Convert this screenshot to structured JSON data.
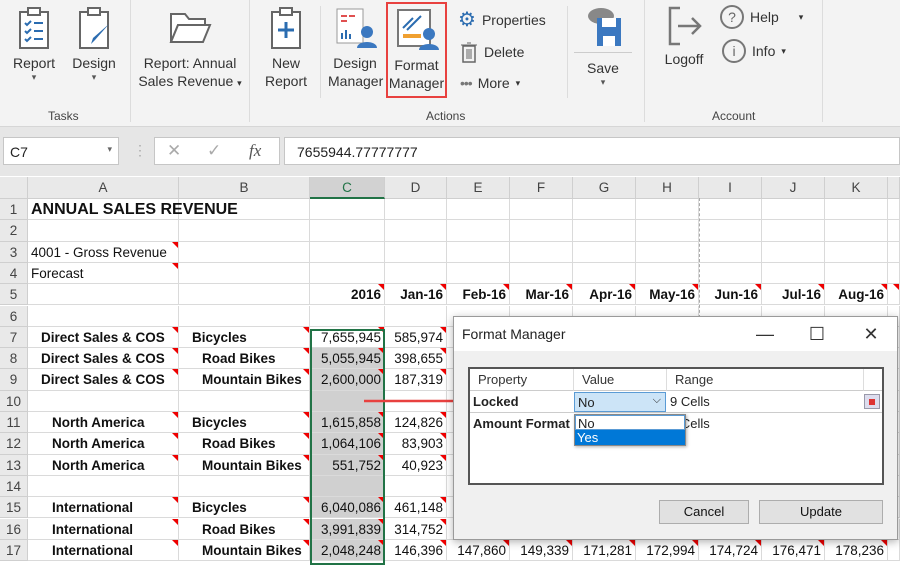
{
  "ribbon": {
    "report": "Report",
    "design": "Design",
    "report_select": "Report: Annual",
    "report_select2": "Sales Revenue",
    "new_report_1": "New",
    "new_report_2": "Report",
    "design_mgr_1": "Design",
    "design_mgr_2": "Manager",
    "format_mgr_1": "Format",
    "format_mgr_2": "Manager",
    "properties": "Properties",
    "delete": "Delete",
    "more": "More",
    "save": "Save",
    "logoff": "Logoff",
    "help": "Help",
    "info": "Info",
    "groups": {
      "tasks": "Tasks",
      "actions": "Actions",
      "account": "Account"
    },
    "highlight_color": "#e8413f"
  },
  "formula_bar": {
    "name_box": "C7",
    "formula": "7655944.77777777"
  },
  "sheet": {
    "columns": [
      "A",
      "B",
      "C",
      "D",
      "E",
      "F",
      "G",
      "H",
      "I",
      "J",
      "K"
    ],
    "selected_column": "C",
    "rows": [
      {
        "n": "1",
        "cells": [
          "ANNUAL SALES REVENUE"
        ]
      },
      {
        "n": "2",
        "cells": []
      },
      {
        "n": "3",
        "cells": [
          "4001 - Gross Revenue"
        ]
      },
      {
        "n": "4",
        "cells": [
          "Forecast"
        ]
      },
      {
        "n": "5",
        "cells": [
          "",
          "",
          "2016",
          "Jan-16",
          "Feb-16",
          "Mar-16",
          "Apr-16",
          "May-16",
          "Jun-16",
          "Jul-16",
          "Aug-16"
        ]
      },
      {
        "n": "6",
        "cells": []
      },
      {
        "n": "7",
        "cells": [
          "Direct Sales & COS",
          "Bicycles",
          "7,655,945",
          "585,974"
        ]
      },
      {
        "n": "8",
        "cells": [
          "Direct Sales & COS",
          "Road Bikes",
          "5,055,945",
          "398,655"
        ]
      },
      {
        "n": "9",
        "cells": [
          "Direct Sales & COS",
          "Mountain Bikes",
          "2,600,000",
          "187,319"
        ]
      },
      {
        "n": "10",
        "cells": []
      },
      {
        "n": "11",
        "cells": [
          "North America",
          "Bicycles",
          "1,615,858",
          "124,826"
        ]
      },
      {
        "n": "12",
        "cells": [
          "North America",
          "Road Bikes",
          "1,064,106",
          "83,903"
        ]
      },
      {
        "n": "13",
        "cells": [
          "North America",
          "Mountain Bikes",
          "551,752",
          "40,923"
        ]
      },
      {
        "n": "14",
        "cells": []
      },
      {
        "n": "15",
        "cells": [
          "International",
          "Bicycles",
          "6,040,086",
          "461,148"
        ]
      },
      {
        "n": "16",
        "cells": [
          "International",
          "Road Bikes",
          "3,991,839",
          "314,752"
        ]
      },
      {
        "n": "17",
        "cells": [
          "International",
          "Mountain Bikes",
          "2,048,248",
          "146,396",
          "147,860",
          "149,339",
          "171,281",
          "172,994",
          "174,724",
          "176,471",
          "178,236"
        ]
      }
    ]
  },
  "dialog": {
    "title": "Format Manager",
    "headers": [
      "Property",
      "Value",
      "Range"
    ],
    "rows": [
      {
        "property": "Locked",
        "value": "No",
        "range": "9 Cells"
      },
      {
        "property": "Amount Format",
        "value": "",
        "range": "9 Cells"
      }
    ],
    "dropdown_options": [
      "No",
      "Yes"
    ],
    "highlighted_option": "Yes",
    "cancel": "Cancel",
    "update": "Update"
  }
}
